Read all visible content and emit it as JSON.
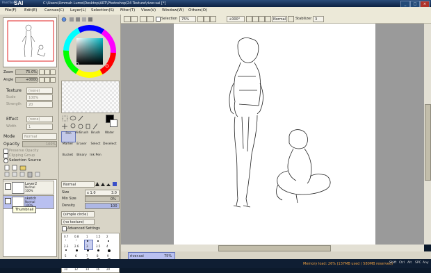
{
  "window": {
    "logo": "PaintTool",
    "app_name": "SAI",
    "path": "C:\\Users\\Ummah Lumo\\Desktop\\ART\\Photoshop\\24 Texture\\river.sai [*]",
    "minimize": "_",
    "maximize": "□",
    "close": "×"
  },
  "menu": {
    "items": [
      "File",
      "Edit",
      "Canvas",
      "Layer",
      "Selection",
      "Filter",
      "View",
      "Window",
      "Others"
    ],
    "accels": [
      "(F)",
      "(E)",
      "(C)",
      "(L)",
      "(S)",
      "(T)",
      "(V)",
      "(W)",
      "(O)"
    ]
  },
  "navigator": {
    "zoom_label": "Zoom",
    "zoom_value": "75.0%",
    "angle_label": "Angle",
    "angle_value": "+0000"
  },
  "effects": {
    "texture_label": "Texture",
    "texture_value": "(none)",
    "scale_label": "Scale",
    "scale_value": "100%",
    "strength_label": "Strength",
    "strength_value": "20",
    "effect_label": "Effect",
    "effect_value": "(none)",
    "width_label": "Width",
    "width_value": "1",
    "mode_label": "Mode",
    "mode_value": "Normal",
    "opacity_label": "Opacity",
    "opacity_value": "100%",
    "preserve_opacity": "Preserve Opacity",
    "clipping_group": "Clipping Group",
    "selection_source": "Selection Source"
  },
  "layers": [
    {
      "name": "Layer2",
      "mode": "Normal",
      "opacity": "100%"
    },
    {
      "name": "sketch",
      "mode": "Normal",
      "opacity": "100%"
    }
  ],
  "tooltip": "Thumbnail",
  "tools": [
    {
      "label": "Pen"
    },
    {
      "label": "AirBrush"
    },
    {
      "label": "Brush"
    },
    {
      "label": "Water"
    },
    {
      "label": "Marker"
    },
    {
      "label": "Eraser"
    },
    {
      "label": "Select"
    },
    {
      "label": "Deselect"
    },
    {
      "label": "Bucket"
    },
    {
      "label": "Binary"
    },
    {
      "label": "Ink Pen"
    },
    {
      "label": ""
    }
  ],
  "brush": {
    "mode": "Normal",
    "size_label": "Size",
    "size_mult": "x 1.0",
    "size_value": "3.0",
    "min_size_label": "Min Size",
    "min_size_value": "0%",
    "density_label": "Density",
    "density_value": "100",
    "shape": "(simple circle)",
    "texture": "(no texture)",
    "advanced": "Advanced Settings",
    "presets_row1": [
      "0.7",
      "0.8",
      "1",
      "1.5",
      "2"
    ],
    "presets_row2": [
      "2.3",
      "2.6",
      "3",
      "3.5",
      "4"
    ],
    "presets_row3": [
      "5",
      "6",
      "7",
      "8",
      "9"
    ],
    "presets_row4": [
      "10",
      "12",
      "14",
      "16",
      "20"
    ]
  },
  "toolbar": {
    "selection_label": "Selection",
    "zoom": "75%",
    "angle": "+000°",
    "mode": "Normal",
    "stabilizer_label": "Stabilizer",
    "stabilizer_value": "3"
  },
  "tab": {
    "name": "river.sai",
    "zoom": "75%"
  },
  "status": {
    "memory": "Memory load: 26% (137MB used / 580MB reserved)",
    "keys": [
      "Shift",
      "Ctrl",
      "Alt",
      "SPC",
      "Any"
    ]
  }
}
